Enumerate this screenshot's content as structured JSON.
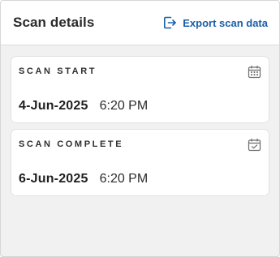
{
  "header": {
    "title": "Scan details",
    "export_label": "Export scan data",
    "export_icon": "export-icon"
  },
  "colors": {
    "accent": "#1a5fa8",
    "panel_background": "#f1f1f1",
    "card_background": "#ffffff"
  },
  "cards": [
    {
      "label": "SCAN START",
      "date": "4-Jun-2025",
      "time": "6:20 PM",
      "icon": "calendar-icon"
    },
    {
      "label": "SCAN COMPLETE",
      "date": "6-Jun-2025",
      "time": "6:20 PM",
      "icon": "calendar-check-icon"
    }
  ]
}
